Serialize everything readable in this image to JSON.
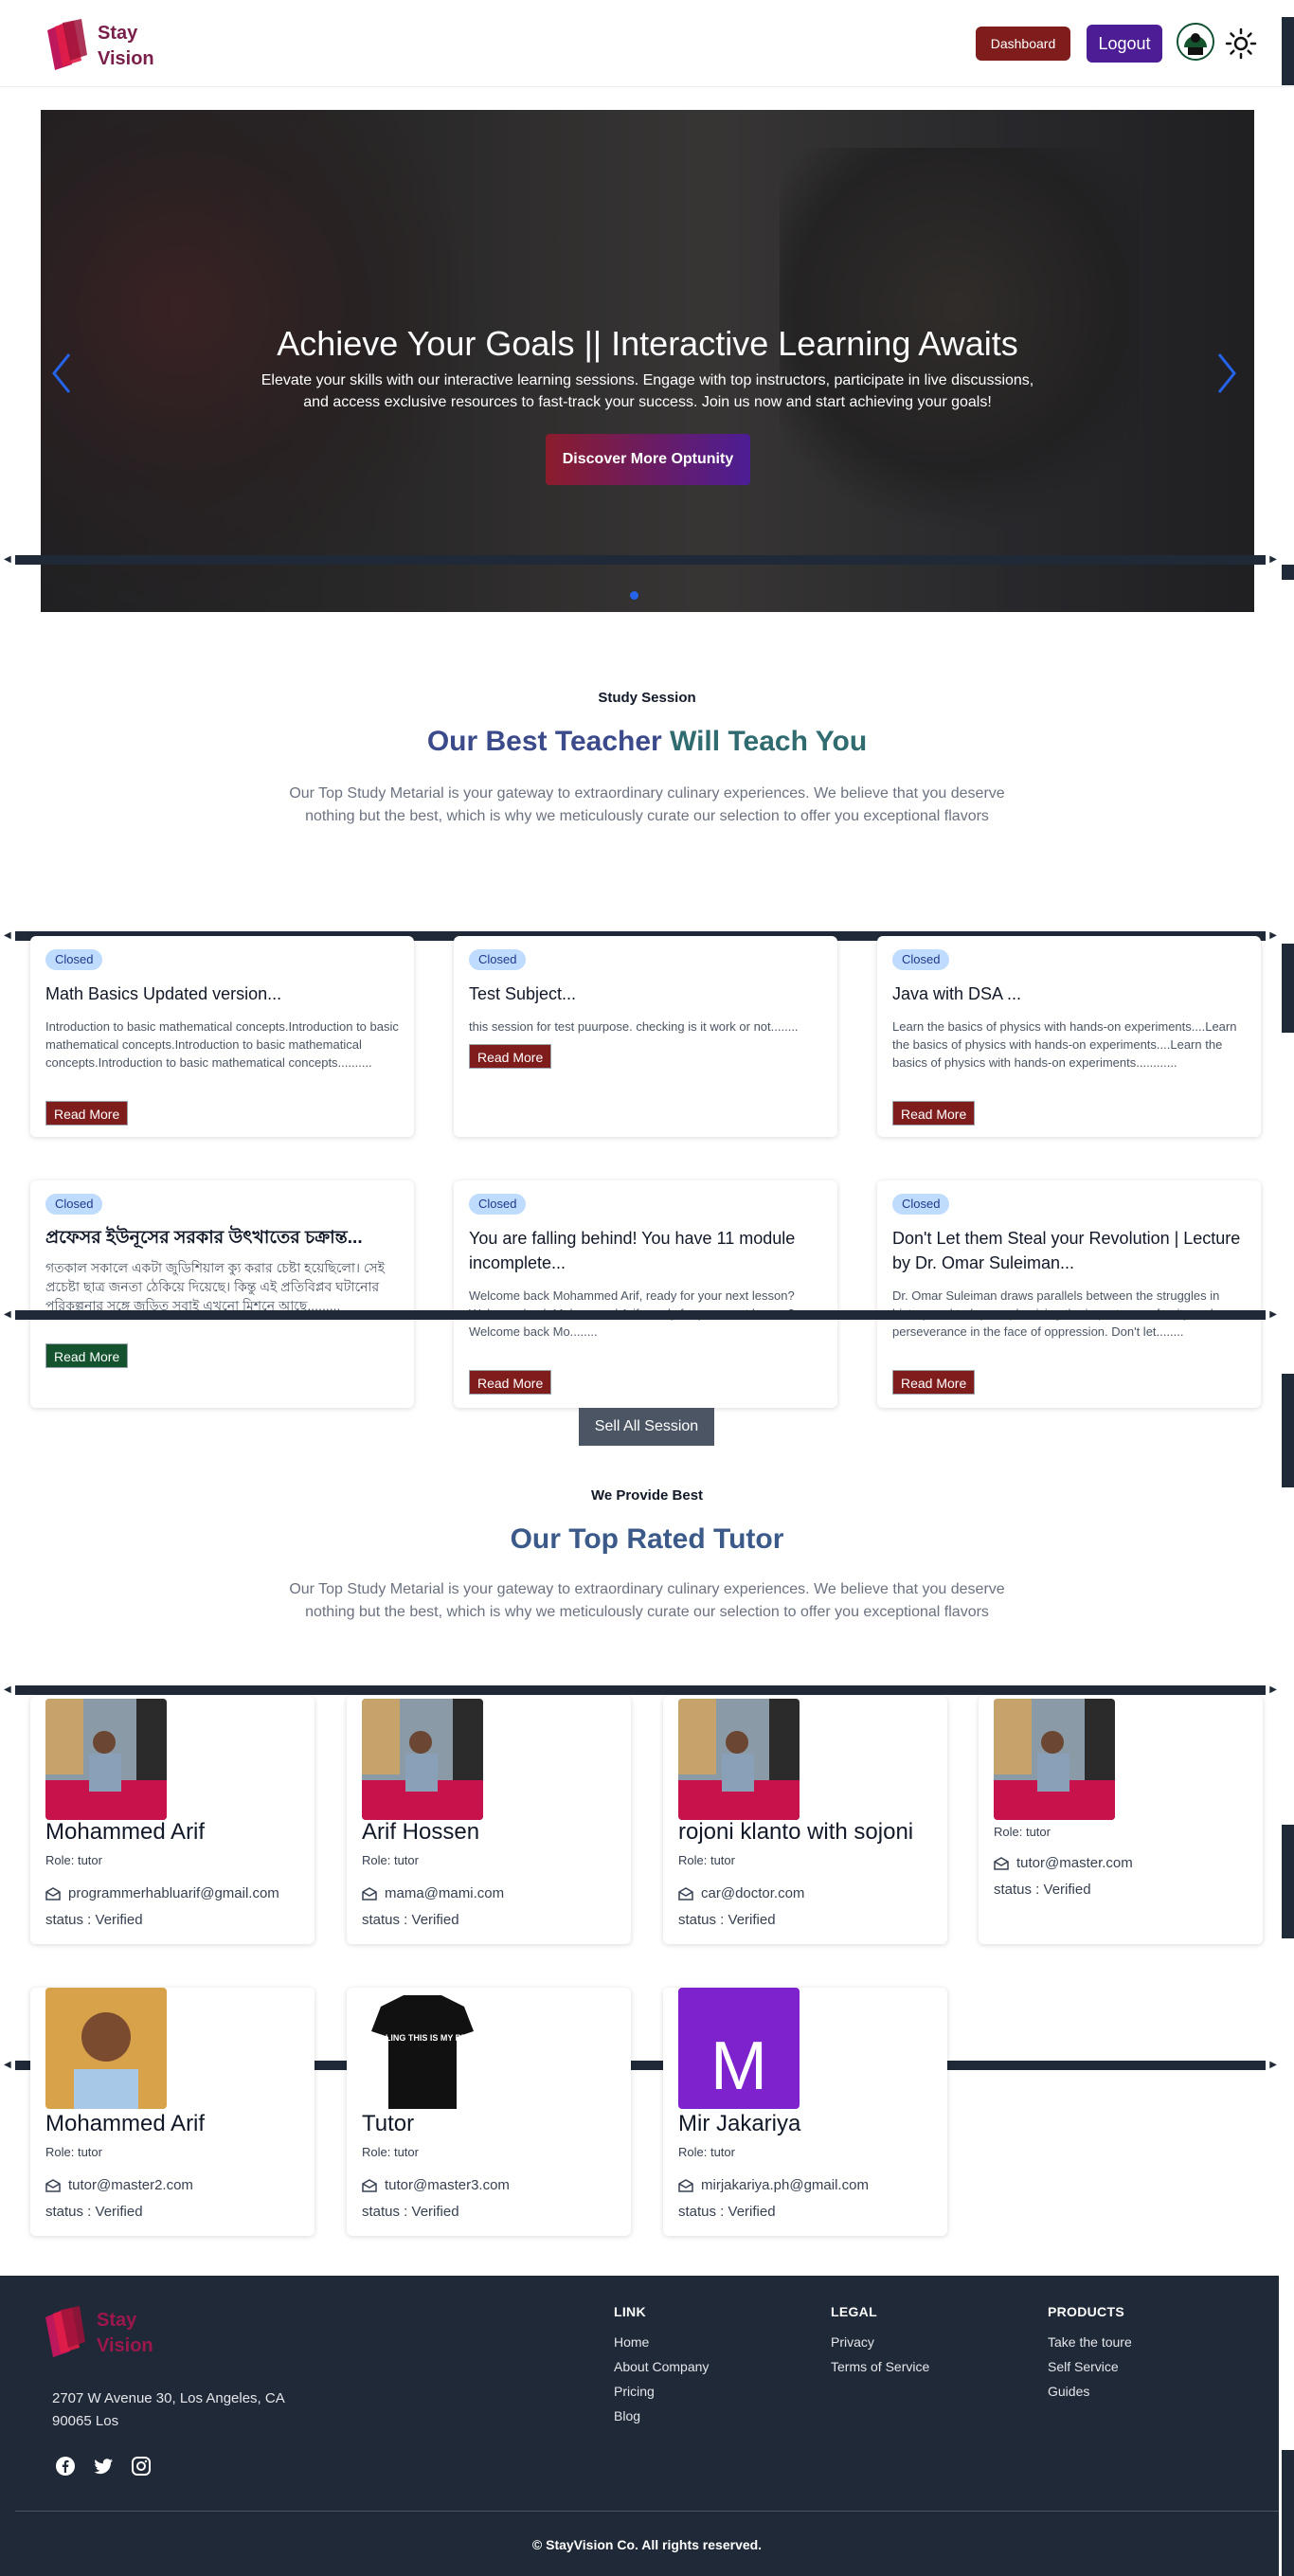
{
  "header": {
    "brand_line1": "Stay",
    "brand_line2": "Vision",
    "dashboard_label": "Dashboard",
    "logout_label": "Logout"
  },
  "hero": {
    "title": "Achieve Your Goals || Interactive Learning Awaits",
    "text": "Elevate your skills with our interactive learning sessions. Engage with top instructors, participate in live discussions, and access exclusive resources to fast-track your success. Join us now and start achieving your goals!",
    "cta_label": "Discover More Optunity"
  },
  "sessions_section": {
    "eyebrow": "Study Session",
    "title_part1": "Our Best Teacher",
    "title_part2": "Will Teach You",
    "subtitle": "Our Top Study Metarial is your gateway to extraordinary culinary experiences. We believe that you deserve nothing but the best, which is why we meticulously curate our selection to offer you exceptional flavors",
    "sessions": [
      {
        "status": "Closed",
        "title": "Math Basics Updated version...",
        "description": "Introduction to basic mathematical concepts.Introduction to basic mathematical concepts.Introduction to basic mathematical concepts.Introduction to basic mathematical concepts..........",
        "button": "Read More"
      },
      {
        "status": "Closed",
        "title": "Test Subject...",
        "description": "this session for test puurpose. checking is it work or not........",
        "button": "Read More"
      },
      {
        "status": "Closed",
        "title": "Java with DSA ...",
        "description": "Learn the basics of physics with hands-on experiments....Learn the basics of physics with hands-on experiments....Learn the basics of physics with hands-on experiments............",
        "button": "Read More"
      },
      {
        "status": "Closed",
        "title": "প্রফেসর ইউনূসের সরকার উৎখাতের চক্রান্ত...",
        "description": "গতকাল সকালে একটা জুডিশিয়াল ক্যু করার চেষ্টা হয়েছিলো। সেই প্রচেষ্টা ছাত্র জনতা ঠেকিয়ে দিয়েছে। কিন্তু এই প্রতিবিপ্লব ঘটানোর পরিকল্পনার সঙ্গে জড়িত সবাই এখনো মিশনে আছে.........",
        "button": "Read More"
      },
      {
        "status": "Closed",
        "title": "You are falling behind! You have 11 module incomplete...",
        "description": "Welcome back Mohammed Arif, ready for your next lesson? Welcome back Mohammed Arif, ready for your next lesson? Welcome back Mo........",
        "button": "Read More"
      },
      {
        "status": "Closed",
        "title": "Don't Let them Steal your Revolution | Lecture by Dr. Omar Suleiman...",
        "description": "Dr. Omar Suleiman draws parallels between the struggles in history and today, emphasizing the importance of unity and perseverance in the face of oppression. Don't let........",
        "button": "Read More"
      }
    ],
    "see_all_label": "Sell All Session"
  },
  "tutors_section": {
    "eyebrow": "We Provide Best",
    "title": "Our Top Rated Tutor",
    "subtitle": "Our Top Study Metarial is your gateway to extraordinary culinary experiences. We believe that you deserve nothing but the best, which is why we meticulously curate our selection to offer you exceptional flavors",
    "tutors": [
      {
        "name": "Mohammed Arif",
        "role": "Role: tutor",
        "email": "programmerhabluarif@gmail.com",
        "status": "status : Verified"
      },
      {
        "name": "Arif Hossen",
        "role": "Role: tutor",
        "email": "mama@mami.com",
        "status": "status : Verified"
      },
      {
        "name": "rojoni klanto with sojoni",
        "role": "Role: tutor",
        "email": "car@doctor.com",
        "status": "status : Verified"
      },
      {
        "name": "",
        "role": "Role: tutor",
        "email": "tutor@master.com",
        "status": "status : Verified"
      },
      {
        "name": "Mohammed Arif",
        "role": "Role: tutor",
        "email": "tutor@master2.com",
        "status": "status : Verified"
      },
      {
        "name": "Tutor",
        "role": "Role: tutor",
        "email": "tutor@master3.com",
        "status": "status : Verified",
        "shirt_text": "I'M NOT YELLING THIS IS MY PE TEACHER"
      },
      {
        "name": "Mir Jakariya",
        "role": "Role: tutor",
        "email": "mirjakariya.ph@gmail.com",
        "status": "status : Verified",
        "initial": "M"
      }
    ]
  },
  "footer": {
    "brand_line1": "Stay",
    "brand_line2": "Vision",
    "address": "2707 W Avenue 30, Los Angeles, CA 90065 Los",
    "columns": [
      {
        "heading": "LINK",
        "items": [
          "Home",
          "About Company",
          "Pricing",
          "Blog"
        ]
      },
      {
        "heading": "LEGAL",
        "items": [
          "Privacy",
          "Terms of Service"
        ]
      },
      {
        "heading": "PRODUCTS",
        "items": [
          "Take the toure",
          "Self Service",
          "Guides"
        ]
      }
    ],
    "social_icons": [
      "facebook-icon",
      "twitter-icon",
      "instagram-icon"
    ],
    "copyright": "© StayVision Co. All rights reserved."
  },
  "colors": {
    "brand": "#7a1f4a",
    "dashboard_button": "#7f1d1d",
    "logout_button": "#4c1d95",
    "heading_blue": "#3b4a8a",
    "heading_teal": "#2f6b6f",
    "badge_bg": "#bfdbfe",
    "read_more_green": "#14532d",
    "read_more_red": "#7f1d1d",
    "footer_bg": "#1f2937"
  }
}
